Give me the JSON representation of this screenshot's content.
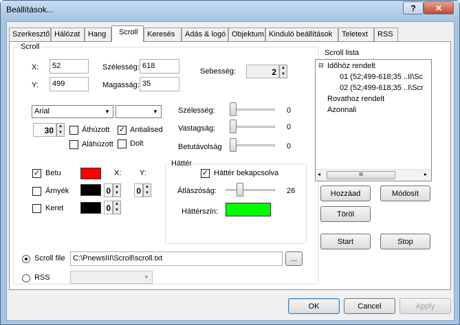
{
  "window": {
    "title": "Beállítások..."
  },
  "tabs": [
    {
      "label": "Szerkesztő"
    },
    {
      "label": "Hálózat"
    },
    {
      "label": "Hang"
    },
    {
      "label": "Scroll"
    },
    {
      "label": "Keresés"
    },
    {
      "label": "Adás & logó"
    },
    {
      "label": "Objektum"
    },
    {
      "label": "Kinduló beállítások"
    },
    {
      "label": "Teletext"
    },
    {
      "label": "RSS"
    }
  ],
  "active_tab": "Scroll",
  "scroll_group": {
    "title": "Scroll",
    "x_label": "X:",
    "x_value": "52",
    "y_label": "Y:",
    "y_value": "499",
    "width_label": "Szélesség:",
    "width_value": "618",
    "height_label": "Magasság:",
    "height_value": "35",
    "speed_label": "Sebesség:",
    "speed_value": "2",
    "font_name": "Arial",
    "font_size": "30",
    "strike_label": "Áthúzott",
    "strike_checked": false,
    "antialias_label": "Antialised",
    "antialias_checked": true,
    "underline_label": "Aláhúzott",
    "underline_checked": false,
    "italic_label": "Dolt",
    "italic_checked": false,
    "slider_width_label": "Szélesség:",
    "slider_width_value": "0",
    "slider_thickness_label": "Vastagság:",
    "slider_thickness_value": "0",
    "slider_spacing_label": "Betutávolság",
    "slider_spacing_value": "0",
    "text_label": "Betu",
    "text_checked": true,
    "text_color": "#ff0000",
    "x_col_label": "X:",
    "y_col_label": "Y:",
    "shadow_label": "Árnyék",
    "shadow_checked": false,
    "shadow_color": "#000000",
    "shadow_x": "0",
    "shadow_y": "0",
    "border_label": "Keret",
    "border_checked": false,
    "border_color": "#000000",
    "border_size": "0",
    "bg_group_title": "Háttér",
    "bg_enabled_label": "Háttér bekapcsolva",
    "bg_enabled_checked": true,
    "opacity_label": "Átlászóság:",
    "opacity_value": "26",
    "bg_color_label": "Háttérszín:",
    "bg_color": "#00ff00",
    "scroll_file_label": "Scroll file",
    "scroll_file_selected": true,
    "scroll_file_path": "C:\\PnewsIII\\Scroll\\scroll.txt",
    "browse_label": "...",
    "rss_label": "RSS",
    "rss_selected": false,
    "rss_value": ""
  },
  "scroll_list": {
    "title": "Scroll lista",
    "items": [
      {
        "text": "Időhöz rendelt",
        "toggle": "⊟"
      },
      {
        "text": "01 (52;499-618;35 ..II\\Sc"
      },
      {
        "text": "02 (52;499-618;35 ..I\\Scr"
      },
      {
        "text": "Rovathoz rendelt"
      },
      {
        "text": "Azonnali"
      }
    ],
    "scroll_thumb": "III"
  },
  "actions": {
    "add": "Hozzáad",
    "modify": "Módosít",
    "delete": "Töröl",
    "start": "Start",
    "stop": "Stop"
  },
  "footer": {
    "ok": "OK",
    "cancel": "Cancel",
    "apply": "Apply"
  },
  "icons": {
    "help": "?",
    "close": "✕",
    "arrow_up": "▲",
    "arrow_down": "▼",
    "check": "✓"
  }
}
